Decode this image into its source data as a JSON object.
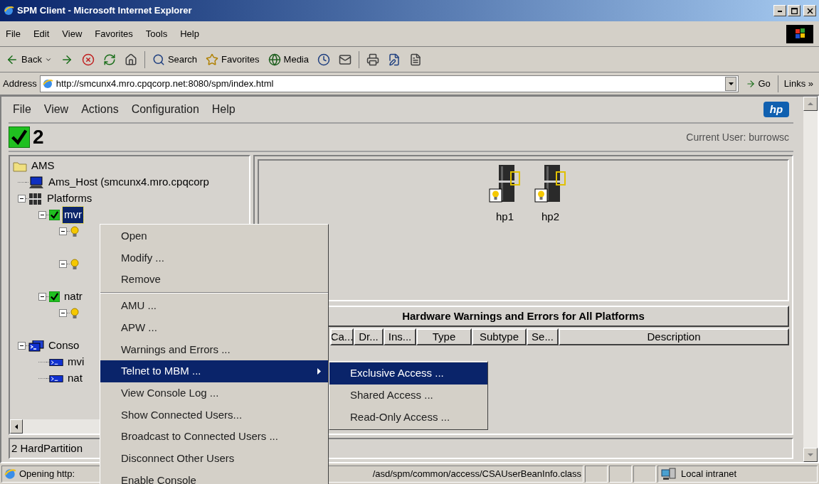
{
  "window": {
    "title": "SPM Client - Microsoft Internet Explorer"
  },
  "menu": [
    "File",
    "Edit",
    "View",
    "Favorites",
    "Tools",
    "Help"
  ],
  "toolbar": [
    {
      "kind": "back",
      "label": "Back"
    },
    {
      "kind": "forward"
    },
    {
      "kind": "stop"
    },
    {
      "kind": "refresh"
    },
    {
      "kind": "home"
    },
    {
      "kind": "search",
      "label": "Search"
    },
    {
      "kind": "favorites",
      "label": "Favorites"
    },
    {
      "kind": "media",
      "label": "Media"
    },
    {
      "kind": "history"
    },
    {
      "kind": "mail"
    },
    {
      "kind": "print"
    },
    {
      "kind": "edit"
    },
    {
      "kind": "discuss"
    }
  ],
  "address": {
    "label": "Address",
    "value": "http://smcunx4.mro.cpqcorp.net:8080/spm/index.html",
    "go": "Go",
    "links": "Links »"
  },
  "applet": {
    "menu": [
      "File",
      "View",
      "Actions",
      "Configuration",
      "Help"
    ],
    "logo": "hp",
    "status_count": "2",
    "current_user": "Current User: burrowsc",
    "tree": [
      {
        "kind": "folder",
        "label": "AMS",
        "selected": false,
        "children": [
          {
            "kind": "host",
            "label": "Ams_Host (smcunx4.mro.cpqcorp",
            "selected": false
          },
          {
            "kind": "platforms",
            "label": "Platforms",
            "selected": false,
            "expanded": true,
            "children": [
              {
                "kind": "platform",
                "label": "mvr",
                "selected": true,
                "expanded": true,
                "children": [
                  {
                    "kind": "partition",
                    "selected": false,
                    "expanded": true
                  },
                  {
                    "kind": "partition",
                    "selected": false,
                    "expanded": true
                  }
                ]
              },
              {
                "kind": "platform",
                "label": "natr",
                "selected": false,
                "expanded": true,
                "children": [
                  {
                    "kind": "partition",
                    "selected": false,
                    "expanded": true
                  }
                ]
              }
            ]
          },
          {
            "kind": "consoles",
            "label": "Conso",
            "selected": false,
            "expanded": true,
            "children": [
              {
                "kind": "console",
                "label": "mvi",
                "selected": false
              },
              {
                "kind": "console",
                "label": "nat",
                "selected": false
              }
            ]
          }
        ]
      }
    ],
    "devices": [
      {
        "label": "hp1"
      },
      {
        "label": "hp2"
      }
    ],
    "table": {
      "title": "Hardware Warnings and Errors for All Platforms",
      "columns": [
        "Ca...",
        "Dr...",
        "Ins...",
        "Type",
        "Subtype",
        "Se...",
        "Description"
      ]
    },
    "status": "2 HardPartition"
  },
  "context_menu": [
    {
      "kind": "item",
      "label": "Open",
      "selected": false,
      "submenu": false
    },
    {
      "kind": "item",
      "label": "Modify ...",
      "selected": false,
      "submenu": false
    },
    {
      "kind": "item",
      "label": "Remove",
      "selected": false,
      "submenu": false
    },
    {
      "kind": "separator"
    },
    {
      "kind": "item",
      "label": "AMU ...",
      "selected": false,
      "submenu": false
    },
    {
      "kind": "item",
      "label": "APW ...",
      "selected": false,
      "submenu": false
    },
    {
      "kind": "item",
      "label": "Warnings and Errors ...",
      "selected": false,
      "submenu": false
    },
    {
      "kind": "item",
      "label": "Telnet to MBM ...",
      "selected": true,
      "submenu": true
    },
    {
      "kind": "item",
      "label": "View Console Log ...",
      "selected": false,
      "submenu": false
    },
    {
      "kind": "item",
      "label": "Show Connected Users...",
      "selected": false,
      "submenu": false
    },
    {
      "kind": "item",
      "label": "Broadcast to Connected Users ...",
      "selected": false,
      "submenu": false
    },
    {
      "kind": "item",
      "label": "Disconnect Other Users",
      "selected": false,
      "submenu": false
    },
    {
      "kind": "item",
      "label": "Enable Console",
      "selected": false,
      "submenu": false
    }
  ],
  "submenu": [
    {
      "label": "Exclusive Access ...",
      "selected": true
    },
    {
      "label": "Shared Access ...",
      "selected": false
    },
    {
      "label": "Read-Only Access ...",
      "selected": false
    }
  ],
  "status_bar": {
    "text": "Opening http:",
    "text_2": "/asd/spm/common/access/CSAUserBeanInfo.class",
    "zone": "Local intranet"
  }
}
